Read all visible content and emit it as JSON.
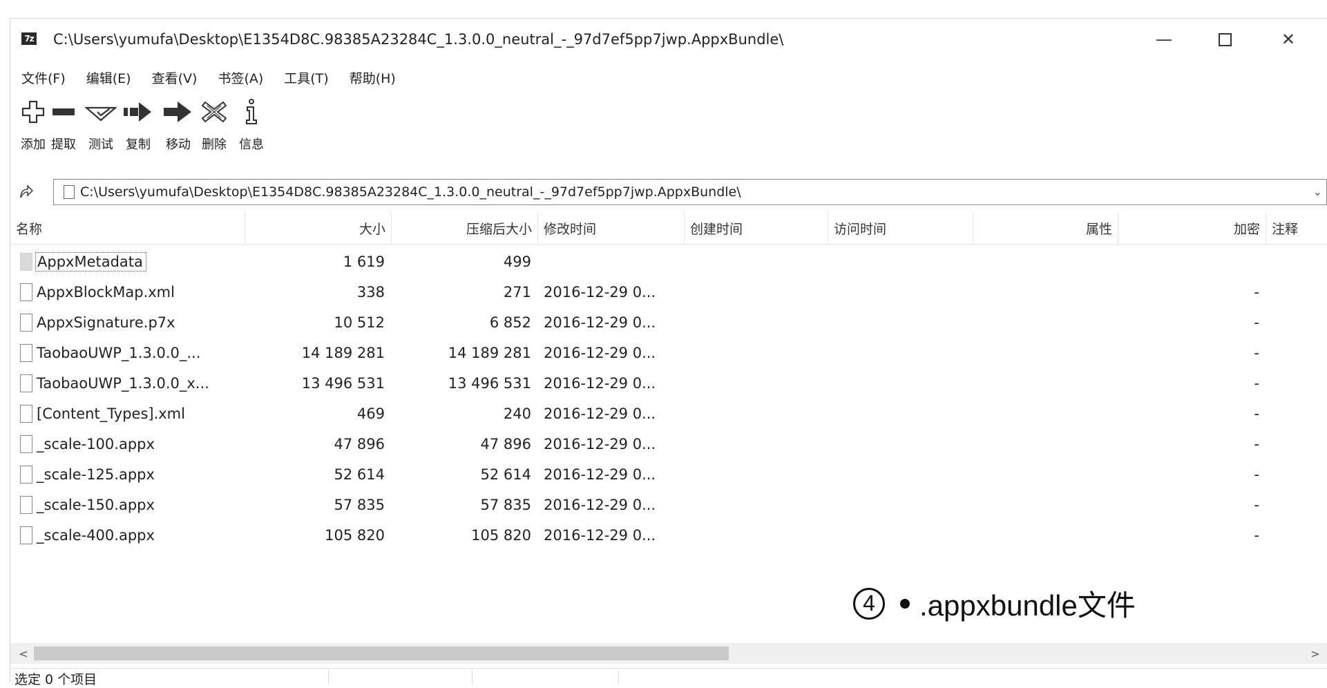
{
  "window": {
    "title": "C:\\Users\\yumufa\\Desktop\\E1354D8C.98385A23284C_1.3.0.0_neutral_-_97d7ef5pp7jwp.AppxBundle\\",
    "app_icon_text": "7z",
    "minimize": "—",
    "close": "✕"
  },
  "menu": [
    "文件(F)",
    "编辑(E)",
    "查看(V)",
    "书签(A)",
    "工具(T)",
    "帮助(H)"
  ],
  "toolbar": {
    "add": "添加",
    "extract": "提取",
    "test": "测试",
    "copy": "复制",
    "move": "移动",
    "delete": "删除",
    "info": "信息"
  },
  "address": {
    "path": "C:\\Users\\yumufa\\Desktop\\E1354D8C.98385A23284C_1.3.0.0_neutral_-_97d7ef5pp7jwp.AppxBundle\\"
  },
  "columns": {
    "name": "名称",
    "size": "大小",
    "packed": "压缩后大小",
    "modified": "修改时间",
    "created": "创建时间",
    "accessed": "访问时间",
    "attributes": "属性",
    "encrypted": "加密",
    "comment": "注释"
  },
  "files": [
    {
      "name": "AppxMetadata",
      "size": "1 619",
      "packed": "499",
      "modified": "",
      "encrypted": ""
    },
    {
      "name": "AppxBlockMap.xml",
      "size": "338",
      "packed": "271",
      "modified": "2016-12-29 0...",
      "encrypted": "-"
    },
    {
      "name": "AppxSignature.p7x",
      "size": "10 512",
      "packed": "6 852",
      "modified": "2016-12-29 0...",
      "encrypted": "-"
    },
    {
      "name": "TaobaoUWP_1.3.0.0_...",
      "size": "14 189 281",
      "packed": "14 189 281",
      "modified": "2016-12-29 0...",
      "encrypted": "-"
    },
    {
      "name": "TaobaoUWP_1.3.0.0_x...",
      "size": "13 496 531",
      "packed": "13 496 531",
      "modified": "2016-12-29 0...",
      "encrypted": "-"
    },
    {
      "name": "[Content_Types].xml",
      "size": "469",
      "packed": "240",
      "modified": "2016-12-29 0...",
      "encrypted": "-"
    },
    {
      "name": "_scale-100.appx",
      "size": "47 896",
      "packed": "47 896",
      "modified": "2016-12-29 0...",
      "encrypted": "-"
    },
    {
      "name": "_scale-125.appx",
      "size": "52 614",
      "packed": "52 614",
      "modified": "2016-12-29 0...",
      "encrypted": "-"
    },
    {
      "name": "_scale-150.appx",
      "size": "57 835",
      "packed": "57 835",
      "modified": "2016-12-29 0...",
      "encrypted": "-"
    },
    {
      "name": "_scale-400.appx",
      "size": "105 820",
      "packed": "105 820",
      "modified": "2016-12-29 0...",
      "encrypted": "-"
    }
  ],
  "annotation": {
    "number": "4",
    "text": ".appxbundle文件"
  },
  "status": {
    "selected": "选定 0 个项目"
  }
}
